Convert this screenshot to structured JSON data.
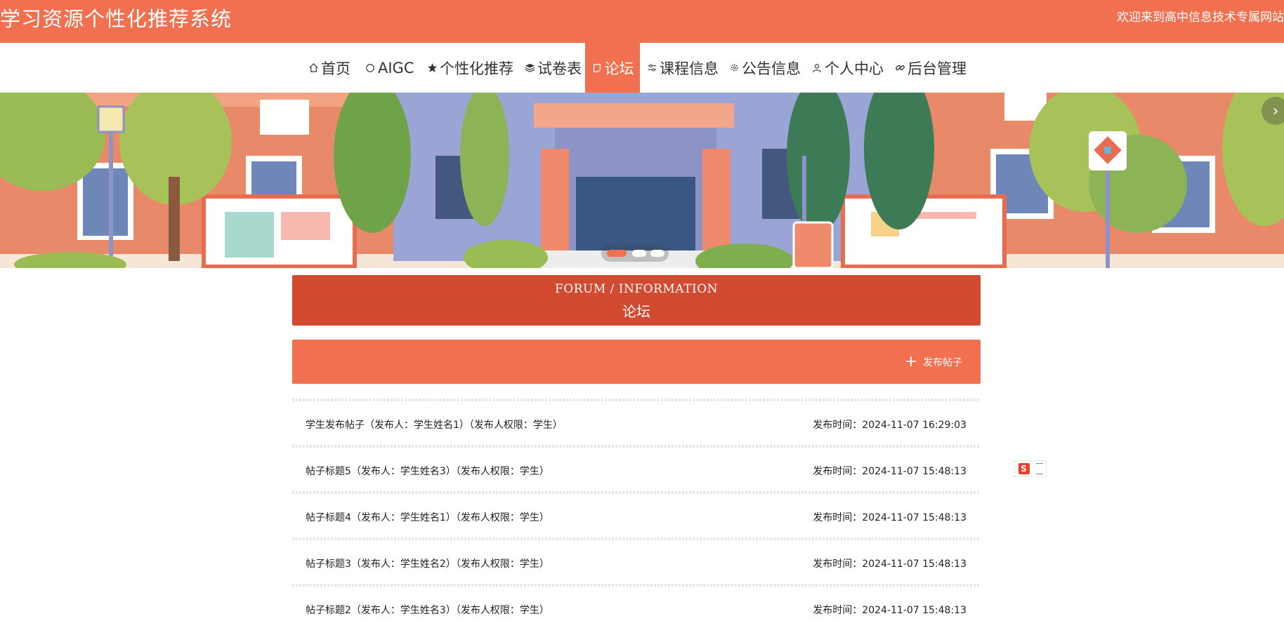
{
  "header": {
    "site_title": "学习资源个性化推荐系统",
    "welcome": "欢迎来到高中信息技术专属网站"
  },
  "nav": {
    "items": [
      {
        "label": "首页",
        "icon": "home-icon"
      },
      {
        "label": "AIGC",
        "icon": "circle-icon"
      },
      {
        "label": "个性化推荐",
        "icon": "star-icon"
      },
      {
        "label": "试卷表",
        "icon": "layers-icon"
      },
      {
        "label": "论坛",
        "icon": "chat-icon",
        "active": true
      },
      {
        "label": "课程信息",
        "icon": "sliders-icon"
      },
      {
        "label": "公告信息",
        "icon": "gear-icon"
      },
      {
        "label": "个人中心",
        "icon": "user-icon"
      },
      {
        "label": "后台管理",
        "icon": "link-icon"
      }
    ]
  },
  "banner": {
    "active_slide": 0,
    "slide_count": 3
  },
  "forum": {
    "title_en": "FORUM / INFORMATION",
    "title_cn": "论坛",
    "post_button": "发布帖子"
  },
  "posts": [
    {
      "title": "学生发布帖子（发布人：学生姓名1）（发布人权限：学生）",
      "time": "发布时间：2024-11-07 16:29:03"
    },
    {
      "title": "帖子标题5（发布人：学生姓名3）（发布人权限：学生）",
      "time": "发布时间：2024-11-07 15:48:13"
    },
    {
      "title": "帖子标题4（发布人：学生姓名1）（发布人权限：学生）",
      "time": "发布时间：2024-11-07 15:48:13"
    },
    {
      "title": "帖子标题3（发布人：学生姓名2）（发布人权限：学生）",
      "time": "发布时间：2024-11-07 15:48:13"
    },
    {
      "title": "帖子标题2（发布人：学生姓名3）（发布人权限：学生）",
      "time": "发布时间：2024-11-07 15:48:13"
    }
  ],
  "widget": {
    "letter": "S"
  },
  "colors": {
    "primary": "#f07050",
    "heading": "#d24a30"
  }
}
